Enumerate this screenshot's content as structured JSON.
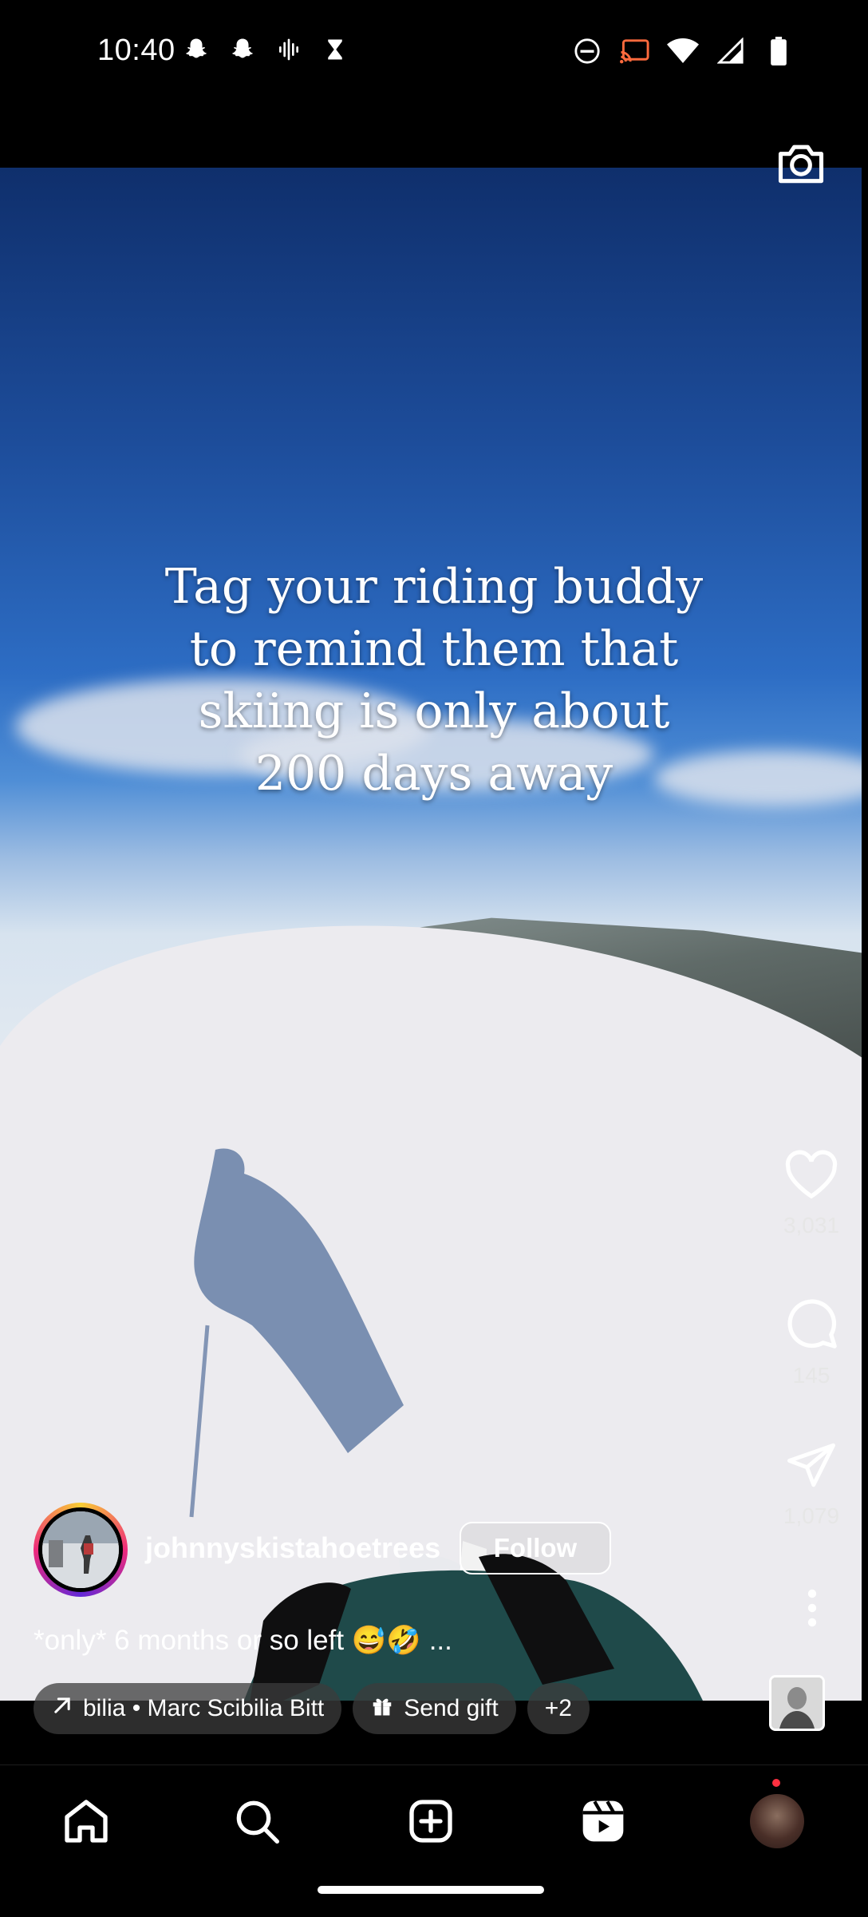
{
  "status_bar": {
    "time": "10:40",
    "left_icons": [
      "snapchat-icon",
      "snapchat-icon",
      "audio-wave-icon",
      "hourglass-icon"
    ],
    "right_icons": [
      "do-not-disturb-icon",
      "cast-icon",
      "wifi-icon",
      "signal-icon",
      "battery-icon"
    ]
  },
  "video": {
    "overlay_lines": [
      "Tag your riding buddy",
      "to remind them that",
      "skiing is only about",
      "200 days away"
    ]
  },
  "actions": {
    "likes": "3,031",
    "comments": "145",
    "shares": "1,079"
  },
  "author": {
    "username": "johnnyskistahoetrees",
    "follow_label": "Follow"
  },
  "caption": "*only* 6 months or so left 😅🤣 ...",
  "chips": {
    "audio": "bilia • Marc Scibilia Bitt",
    "gift": "Send gift",
    "more": "+2"
  },
  "nav": {
    "items": [
      "home-icon",
      "search-icon",
      "create-icon",
      "reels-icon",
      "profile-avatar"
    ]
  },
  "colors": {
    "background": "#000000",
    "notification_dot": "#ff3040"
  }
}
